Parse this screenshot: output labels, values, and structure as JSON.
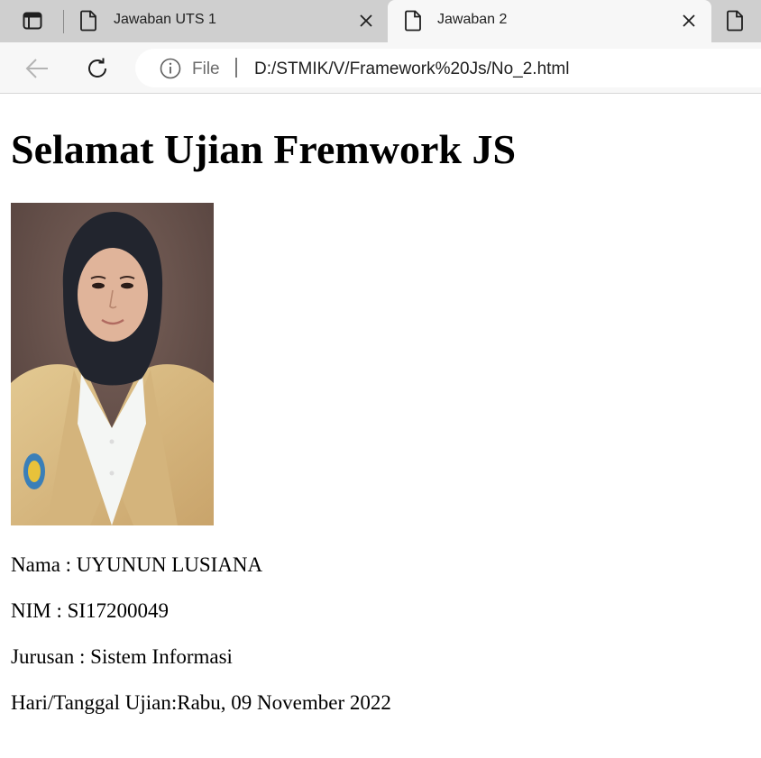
{
  "tabs": [
    {
      "label": "Jawaban UTS 1",
      "active": false
    },
    {
      "label": "Jawaban 2",
      "active": true
    }
  ],
  "address": {
    "scheme": "File",
    "url": "D:/STMIK/V/Framework%20Js/No_2.html"
  },
  "page": {
    "title": "Selamat Ujian Fremwork JS",
    "lines": {
      "nama": "Nama : UYUNUN LUSIANA",
      "nim": "NIM : SI17200049",
      "jurusan": "Jurusan : Sistem Informasi",
      "tanggal": "Hari/Tanggal Ujian:Rabu, 09 November 2022"
    }
  },
  "icons": {
    "tab_actions": "tab-actions-icon",
    "tab_page": "page-icon",
    "close": "close-icon",
    "back": "back-arrow-icon",
    "reload": "reload-icon",
    "info": "info-icon"
  },
  "colors": {
    "tabstrip": "#cfcfcf",
    "active_tab": "#f7f7f7",
    "photo_background": "#6b5550",
    "jacket": "#d9bc86",
    "hijab": "#22252e"
  }
}
